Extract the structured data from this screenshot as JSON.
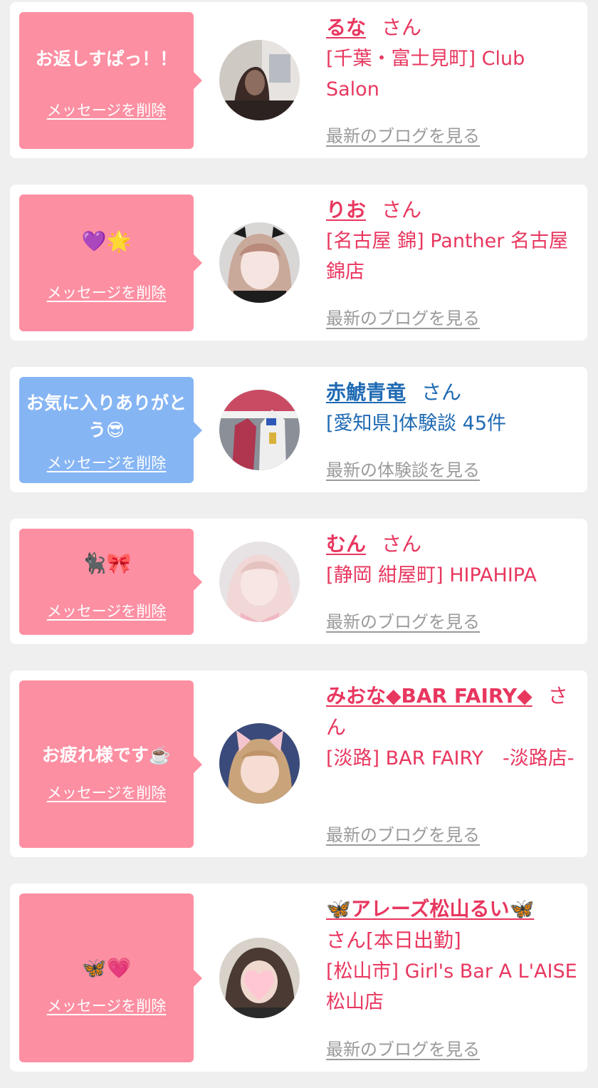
{
  "entries": [
    {
      "message": "お返しすぱっ！！",
      "delete_label": "メッセージを削除",
      "name": "るな",
      "suffix": "さん",
      "shop": "[千葉・富士見町] Club Salon",
      "link": "最新のブログを見る",
      "bubble_color": "#fd8fa2"
    },
    {
      "message": "💜🌟",
      "delete_label": "メッセージを削除",
      "name": "りお",
      "suffix": "さん",
      "shop": "[名古屋 錦] Panther 名古屋錦店",
      "link": "最新のブログを見る",
      "bubble_color": "#fd8fa2"
    },
    {
      "message": "お気に入りありがとう😎",
      "delete_label": "メッセージを削除",
      "name": "赤鯱青竜",
      "suffix": "さん",
      "shop": "[愛知県]体験談 45件",
      "link": "最新の体験談を見る",
      "bubble_color": "#86b5f4"
    },
    {
      "message": "🐈‍⬛🎀",
      "delete_label": "メッセージを削除",
      "name": "むん",
      "suffix": "さん",
      "shop": "[静岡 紺屋町] HIPAHIPA",
      "link": "最新のブログを見る",
      "bubble_color": "#fd8fa2"
    },
    {
      "message": "お疲れ様です☕️",
      "delete_label": "メッセージを削除",
      "name": "みおな◆BAR FAIRY◆",
      "suffix": "さん",
      "shop": "[淡路] BAR FAIRY　-淡路店-",
      "link": "最新のブログを見る",
      "bubble_color": "#fd8fa2"
    },
    {
      "message": "🦋💗",
      "delete_label": "メッセージを削除",
      "name": "🦋アレーズ松山るい🦋",
      "suffix": "さん[本日出勤]",
      "shop": "[松山市] Girl's Bar A L'AISE 松山店",
      "link": "最新のブログを見る",
      "bubble_color": "#fd8fa2"
    }
  ]
}
